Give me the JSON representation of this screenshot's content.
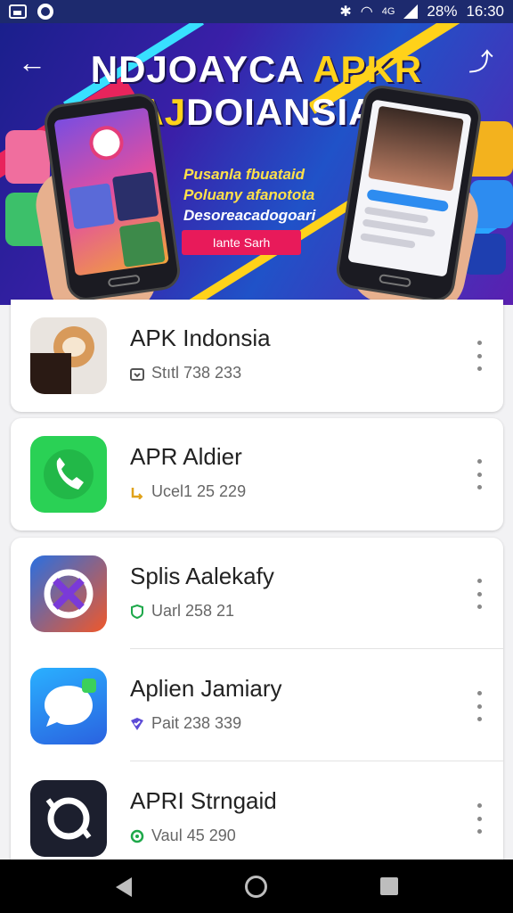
{
  "status_bar": {
    "battery": "28%",
    "time": "16:30",
    "signal_label": "4G"
  },
  "banner": {
    "title_line1_white": "NDJOAYCA",
    "title_line1_yellow": "APKR",
    "title_line2_yellow": "AJ",
    "title_line2_white": "DOIANSIA",
    "tagline_1": "Pusanla fbuataid",
    "tagline_2": "Poluany afanotota",
    "tagline_3": "Desoreacadogoari",
    "cta_label": "Iante Sarh"
  },
  "apps": [
    {
      "name": "APK Indonsia",
      "meta": "Stıtl 738 233",
      "meta_icon": "download-box-icon",
      "icon": "fox-app-icon",
      "meta_color": "#555555"
    },
    {
      "name": "APR Aldier",
      "meta": "Ucel1 25 229",
      "meta_icon": "corner-arrow-icon",
      "icon": "phone-app-icon",
      "meta_color": "#e0a21a"
    },
    {
      "name": "Splis Aalekafy",
      "meta": "Uarl 258 21",
      "meta_icon": "shield-icon",
      "icon": "cross-app-icon",
      "meta_color": "#1ea84a"
    },
    {
      "name": "Aplien Jamiary",
      "meta": "Pait 238 339",
      "meta_icon": "check-badge-icon",
      "icon": "chat-app-icon",
      "meta_color": "#5b4ad6"
    },
    {
      "name": "APRI Strngaid",
      "meta": "Vaul 45 290",
      "meta_icon": "refresh-icon",
      "icon": "sync-app-icon",
      "meta_color": "#1ea84a"
    }
  ]
}
